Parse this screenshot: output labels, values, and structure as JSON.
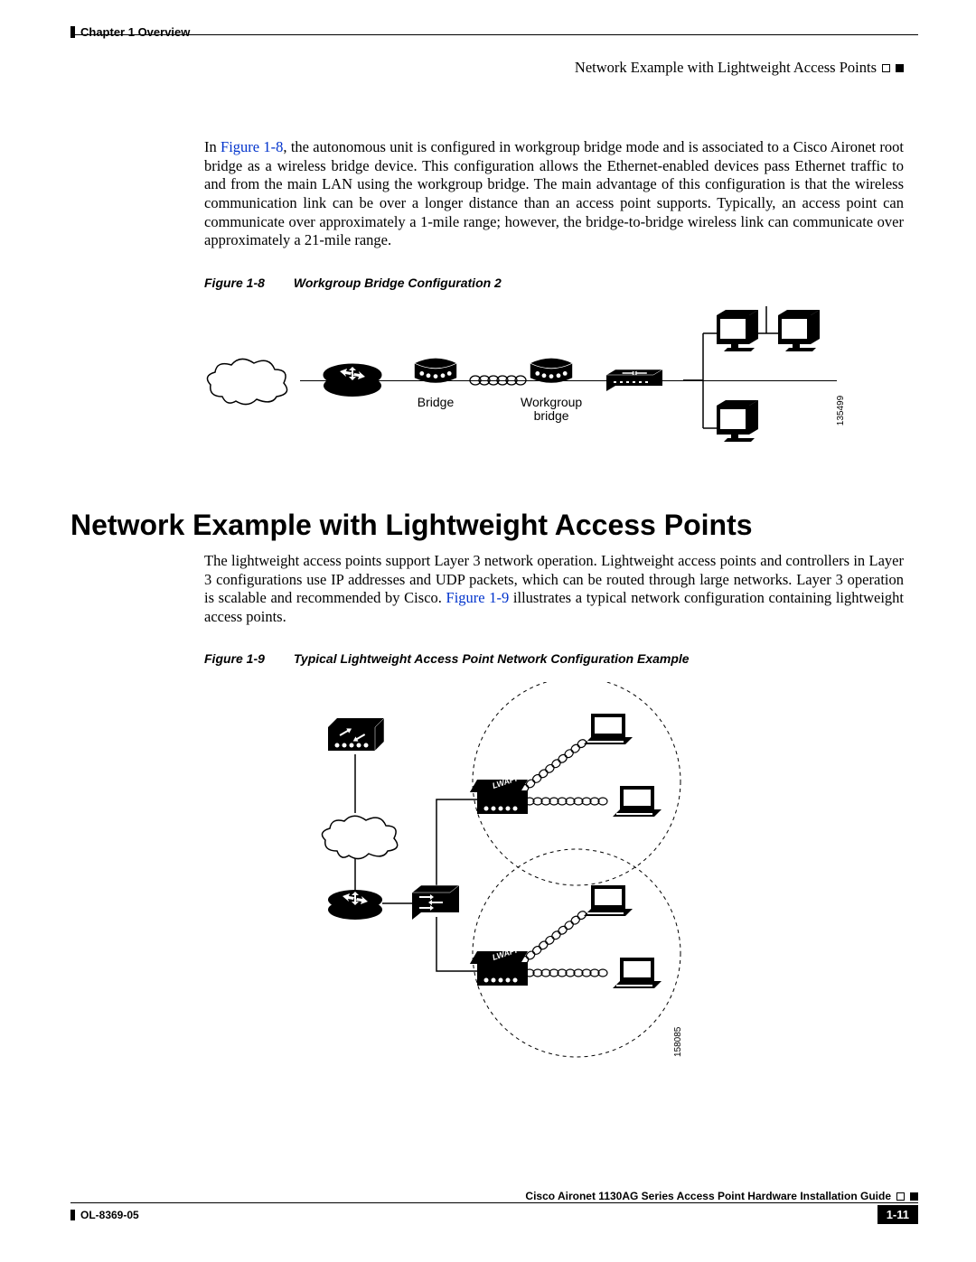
{
  "header": {
    "left": "Chapter 1    Overview",
    "right": "Network Example with Lightweight Access Points"
  },
  "para1_prefix": "In ",
  "para1_link": "Figure 1-8",
  "para1_rest": ", the autonomous unit is configured in workgroup bridge mode and is associated to a Cisco Aironet root bridge as a wireless bridge device. This configuration allows the Ethernet-enabled devices pass Ethernet traffic to and from the main LAN using the workgroup bridge. The main advantage of this configuration is that the wireless communication link can be over a longer distance than an access point supports. Typically, an access point can communicate over approximately a 1-mile range; however, the bridge-to-bridge wireless link can communicate over approximately a 21-mile range.",
  "figure8": {
    "num": "Figure 1-8",
    "title": "Workgroup Bridge Configuration 2",
    "bridge_label": "Bridge",
    "wgb_label_line1": "Workgroup",
    "wgb_label_line2": "bridge",
    "image_no": "135499"
  },
  "section_title": "Network Example with Lightweight Access Points",
  "para2_pre": "The lightweight access points support Layer 3 network operation. Lightweight access points and controllers in Layer 3 configurations use IP addresses and UDP packets, which can be routed through large networks. Layer 3 operation is scalable and recommended by Cisco. ",
  "para2_link": "Figure 1-9",
  "para2_post": " illustrates a typical network configuration containing lightweight access points.",
  "figure9": {
    "num": "Figure 1-9",
    "title": "Typical Lightweight Access Point Network Configuration Example",
    "lwapp": "LWAPP",
    "image_no": "158085"
  },
  "footer": {
    "doc_title": "Cisco Aironet 1130AG Series Access Point Hardware Installation Guide",
    "doc_id": "OL-8369-05",
    "page_num": "1-11"
  }
}
